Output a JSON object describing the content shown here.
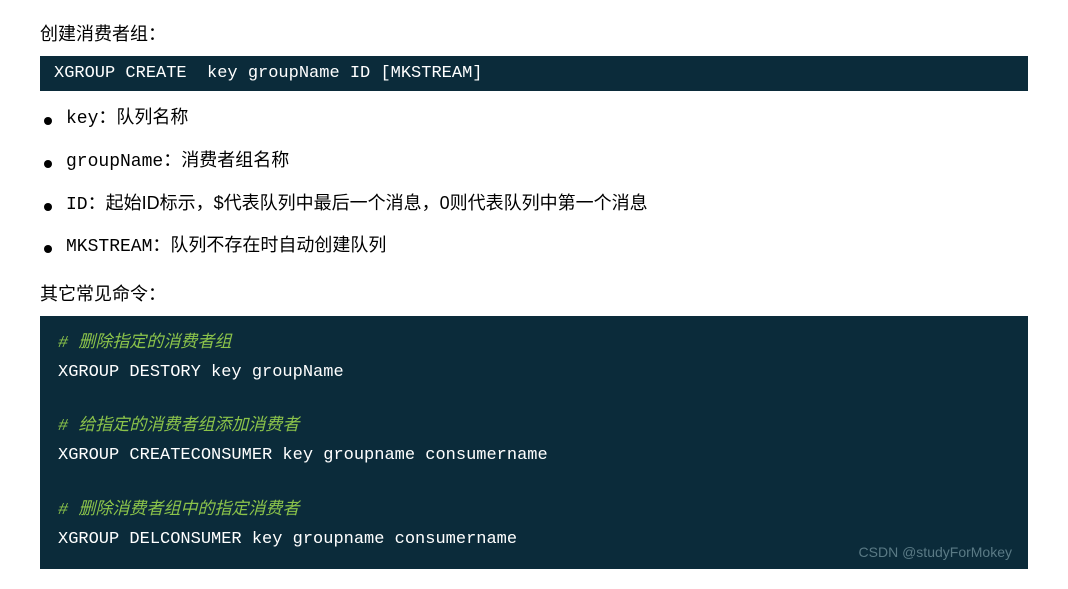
{
  "heading1": "创建消费者组：",
  "codeSingle": "XGROUP CREATE  key groupName ID [MKSTREAM]",
  "bullets": [
    {
      "label": "key：",
      "desc": "队列名称"
    },
    {
      "label": "groupName：",
      "desc": "消费者组名称"
    },
    {
      "label": "ID：",
      "desc": "起始ID标示，$代表队列中最后一个消息，0则代表队列中第一个消息"
    },
    {
      "label": "MKSTREAM：",
      "desc": "队列不存在时自动创建队列"
    }
  ],
  "heading2": "其它常见命令：",
  "codeMulti": {
    "comment1": "# 删除指定的消费者组",
    "line1": "XGROUP DESTORY key groupName",
    "comment2": "# 给指定的消费者组添加消费者",
    "line2": "XGROUP CREATECONSUMER key groupname consumername",
    "comment3": "# 删除消费者组中的指定消费者",
    "line3": "XGROUP DELCONSUMER key groupname consumername"
  },
  "watermark": "CSDN @studyForMokey"
}
